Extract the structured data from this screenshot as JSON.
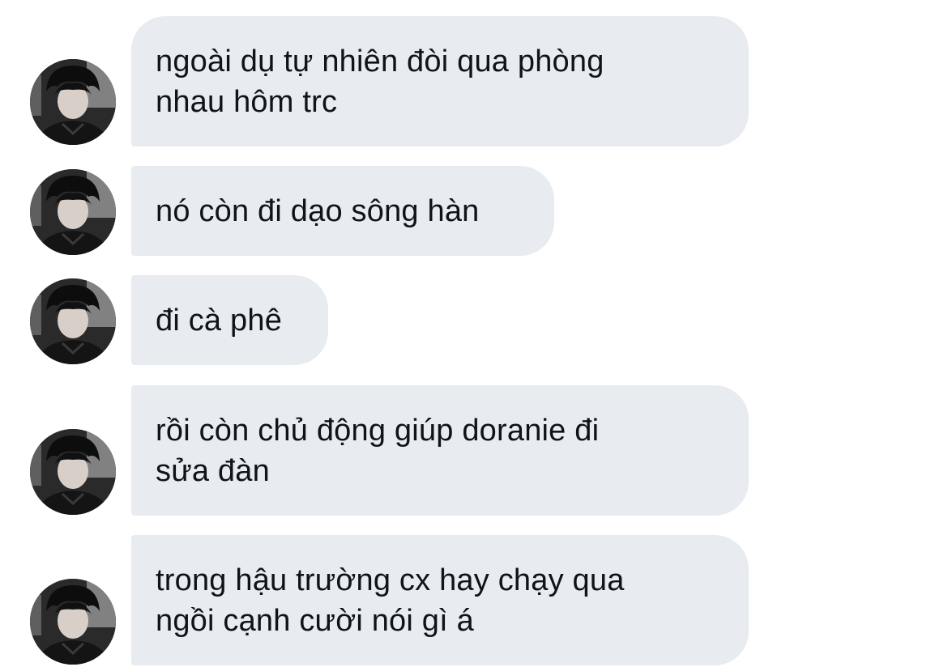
{
  "conversation": {
    "messages": [
      {
        "text": "ngoài dụ tự nhiên đòi qua phòng\nnhau hôm trc"
      },
      {
        "text": "nó còn đi dạo sông hàn"
      },
      {
        "text": "đi cà phê"
      },
      {
        "text": "rồi còn chủ động giúp doranie đi\nsửa đàn"
      },
      {
        "text": "trong hậu trường cx hay chạy qua\nngồi cạnh cười nói gì á"
      }
    ]
  },
  "colors": {
    "bubble_background": "#e8ebef",
    "text": "#0f1419",
    "page_background": "#ffffff"
  },
  "icons": {
    "avatar": "avatar-photo"
  }
}
